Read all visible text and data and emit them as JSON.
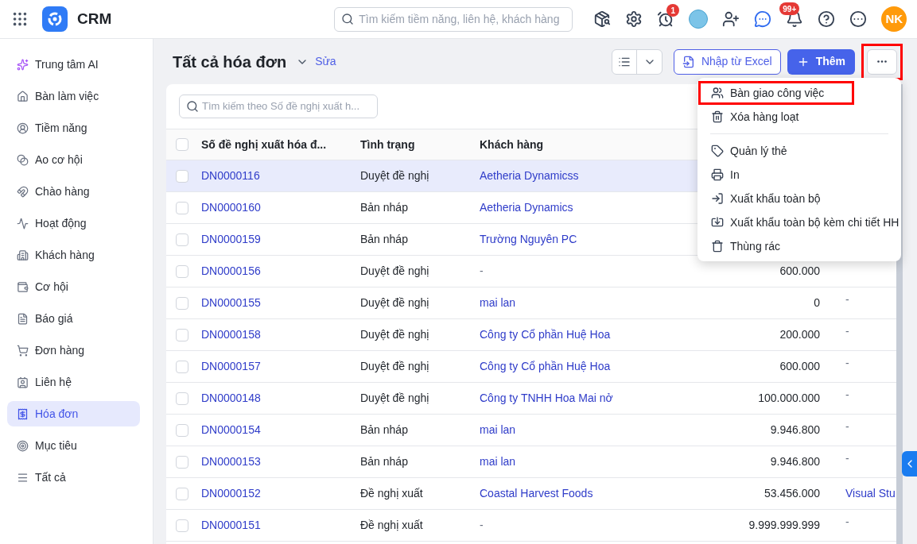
{
  "app": {
    "name": "CRM"
  },
  "top_search": {
    "placeholder": "Tìm kiếm tiềm năng, liên hệ, khách hàng"
  },
  "header": {
    "timer_badge": "1",
    "bell_badge": "99+",
    "user_initials": "NK"
  },
  "sidebar": {
    "items": [
      {
        "label": "Trung tâm AI",
        "selected": false
      },
      {
        "label": "Bàn làm việc",
        "selected": false
      },
      {
        "label": "Tiềm năng",
        "selected": false
      },
      {
        "label": "Ao cơ hội",
        "selected": false
      },
      {
        "label": "Chào hàng",
        "selected": false
      },
      {
        "label": "Hoạt động",
        "selected": false
      },
      {
        "label": "Khách hàng",
        "selected": false
      },
      {
        "label": "Cơ hội",
        "selected": false
      },
      {
        "label": "Báo giá",
        "selected": false
      },
      {
        "label": "Đơn hàng",
        "selected": false
      },
      {
        "label": "Liên hệ",
        "selected": false
      },
      {
        "label": "Hóa đơn",
        "selected": true
      },
      {
        "label": "Mục tiêu",
        "selected": false
      },
      {
        "label": "Tất cả",
        "selected": false
      }
    ]
  },
  "page": {
    "title": "Tất cả hóa đơn",
    "edit_link": "Sửa"
  },
  "actions": {
    "import": "Nhập từ Excel",
    "add": "Thêm",
    "more_highlighted": true
  },
  "table": {
    "search_placeholder": "Tìm kiếm theo Số đề nghị xuất h...",
    "all_checked": false,
    "columns": [
      "Số đề nghị xuất hóa đ...",
      "Tình trạng",
      "Khách hàng"
    ],
    "rows": [
      {
        "number": "DN0000116",
        "status": "Duyệt đề nghị",
        "customer": "Aetheria Dynamicss",
        "customer_link": true,
        "checked": false,
        "selected": true
      },
      {
        "number": "DN0000160",
        "status": "Bản nháp",
        "customer": "Aetheria Dynamics",
        "customer_link": true,
        "checked": false,
        "selected": false
      },
      {
        "number": "DN0000159",
        "status": "Bản nháp",
        "customer": "Trường Nguyên PC",
        "customer_link": true,
        "checked": false,
        "selected": false
      },
      {
        "number": "DN0000156",
        "status": "Duyệt đề nghị",
        "customer": "-",
        "customer_link": false,
        "amount": "600.000",
        "checked": false,
        "selected": false
      },
      {
        "number": "DN0000155",
        "status": "Duyệt đề nghị",
        "customer": "mai lan",
        "customer_link": true,
        "amount": "0",
        "column_5": "-",
        "column_5_link": false,
        "checked": false,
        "selected": false
      },
      {
        "number": "DN0000158",
        "status": "Duyệt đề nghị",
        "customer": "Công ty Cổ phần Huệ Hoa",
        "customer_link": true,
        "amount": "200.000",
        "column_5": "-",
        "column_5_link": false,
        "checked": false,
        "selected": false
      },
      {
        "number": "DN0000157",
        "status": "Duyệt đề nghị",
        "customer": "Công ty Cổ phần Huệ Hoa",
        "customer_link": true,
        "amount": "600.000",
        "column_5": "-",
        "column_5_link": false,
        "checked": false,
        "selected": false
      },
      {
        "number": "DN0000148",
        "status": "Duyệt đề nghị",
        "customer": "Công ty TNHH Hoa Mai nở",
        "customer_link": true,
        "amount": "100.000.000",
        "column_5": "-",
        "column_5_link": false,
        "checked": false,
        "selected": false
      },
      {
        "number": "DN0000154",
        "status": "Bản nháp",
        "customer": "mai lan",
        "customer_link": true,
        "amount": "9.946.800",
        "column_5": "-",
        "column_5_link": false,
        "checked": false,
        "selected": false
      },
      {
        "number": "DN0000153",
        "status": "Bản nháp",
        "customer": "mai lan",
        "customer_link": true,
        "amount": "9.946.800",
        "column_5": "-",
        "column_5_link": false,
        "checked": false,
        "selected": false
      },
      {
        "number": "DN0000152",
        "status": "Đề nghị xuất",
        "customer": "Coastal Harvest Foods",
        "customer_link": true,
        "amount": "53.456.000",
        "column_5": "Visual Stu",
        "column_5_link": true,
        "checked": false,
        "selected": false
      },
      {
        "number": "DN0000151",
        "status": "Đề nghị xuất",
        "customer": "-",
        "customer_link": false,
        "amount": "9.999.999.999",
        "column_5": "-",
        "column_5_link": false,
        "checked": false,
        "selected": false
      }
    ]
  },
  "menu": {
    "groups": [
      [
        {
          "label": "Bàn giao công việc",
          "highlighted": true
        },
        {
          "label": "Xóa hàng loạt",
          "highlighted": false
        }
      ],
      [
        {
          "label": "Quản lý thẻ",
          "highlighted": false
        },
        {
          "label": "In",
          "highlighted": false
        },
        {
          "label": "Xuất khẩu toàn bộ",
          "highlighted": false
        },
        {
          "label": "Xuất khẩu toàn bộ kèm chi tiết HH",
          "highlighted": false
        },
        {
          "label": "Thùng rác",
          "highlighted": false
        }
      ]
    ]
  }
}
